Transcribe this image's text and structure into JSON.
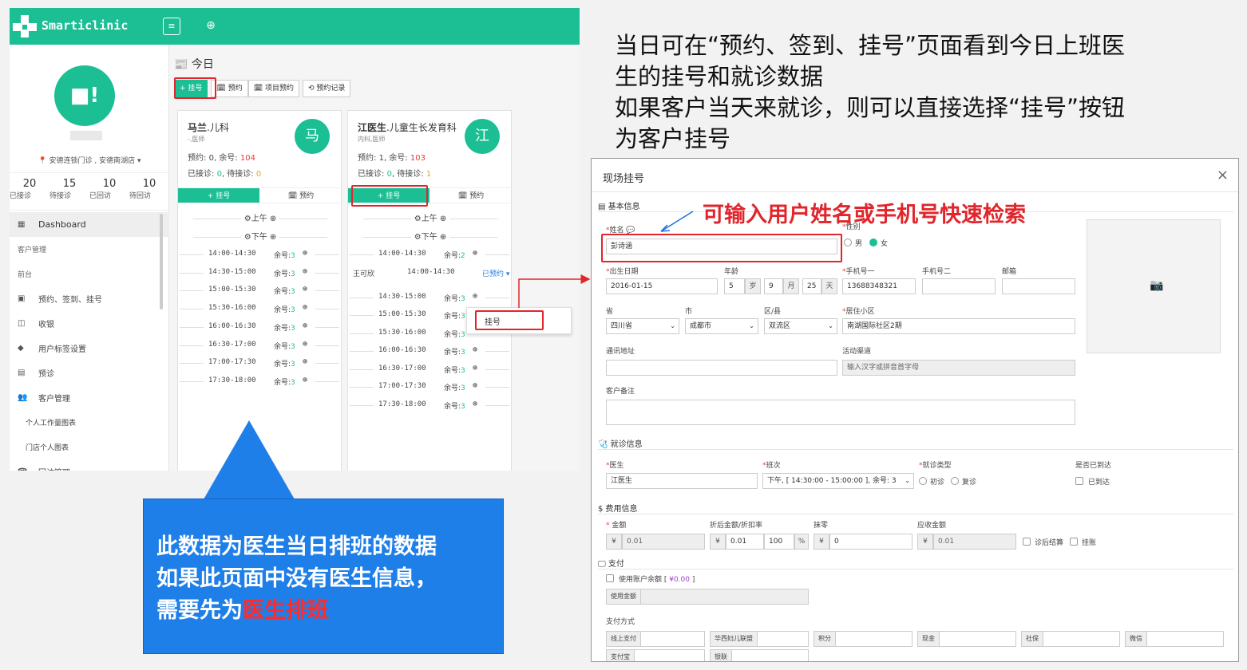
{
  "app": {
    "brand": "Smarticlinic",
    "topbar": {
      "menu_icon": "≡",
      "add_icon": "⊕"
    },
    "avatar_text": "■!",
    "store": "📍 安德连锁门诊 , 安德南湖店 ▾",
    "stats": [
      {
        "num": "20",
        "label": "已接诊"
      },
      {
        "num": "15",
        "label": "待接诊"
      },
      {
        "num": "10",
        "label": "已回访"
      },
      {
        "num": "10",
        "label": "待回访"
      }
    ],
    "menu": [
      {
        "icon": "▦",
        "label": "Dashboard",
        "type": "active"
      },
      {
        "icon": "",
        "label": "客户管理",
        "type": "section"
      },
      {
        "icon": "",
        "label": "前台",
        "type": "section"
      },
      {
        "icon": "▣",
        "label": "预约、签到、挂号",
        "type": "item"
      },
      {
        "icon": "◫",
        "label": "收银",
        "type": "item"
      },
      {
        "icon": "◆",
        "label": "用户标签设置",
        "type": "item"
      },
      {
        "icon": "▤",
        "label": "预诊",
        "type": "item"
      },
      {
        "icon": "👥",
        "label": "客户管理",
        "type": "item"
      },
      {
        "icon": "",
        "label": "个人工作量图表",
        "type": "sub"
      },
      {
        "icon": "",
        "label": "门店个人图表",
        "type": "sub"
      },
      {
        "icon": "☎",
        "label": "回访管理",
        "type": "item"
      }
    ],
    "today_title": "📰 今日",
    "actions": {
      "register": "+ 挂号",
      "appointment": "🗓 预约",
      "project_appt": "🗓 项目预约",
      "records": "⟲ 预约记录"
    },
    "doctors": [
      {
        "name_bold": "马兰",
        "name_rest": ".儿科",
        "title": "-,医师",
        "appt_label": "预约:",
        "appt_value": "0",
        "remain_label": ", 余号:",
        "remain_value": "104",
        "seen_label": "已接诊:",
        "seen_value": "0",
        "wait_label": ", 待接诊:",
        "wait_value": "0",
        "avatar": "马",
        "btn_register": "+ 挂号",
        "btn_appt": "🗓 预约",
        "morning": "⚙上午 ⊕",
        "afternoon": "⚙下午 ⊕",
        "slots": [
          {
            "time": "14:00-14:30",
            "rem_label": "余号:",
            "rem": "3"
          },
          {
            "time": "14:30-15:00",
            "rem_label": "余号:",
            "rem": "3"
          },
          {
            "time": "15:00-15:30",
            "rem_label": "余号:",
            "rem": "3"
          },
          {
            "time": "15:30-16:00",
            "rem_label": "余号:",
            "rem": "3"
          },
          {
            "time": "16:00-16:30",
            "rem_label": "余号:",
            "rem": "3"
          },
          {
            "time": "16:30-17:00",
            "rem_label": "余号:",
            "rem": "3"
          },
          {
            "time": "17:00-17:30",
            "rem_label": "余号:",
            "rem": "3"
          },
          {
            "time": "17:30-18:00",
            "rem_label": "余号:",
            "rem": "3"
          }
        ]
      },
      {
        "name_bold": "江医生",
        "name_rest": ".儿童生长发育科",
        "title": "内科,医师",
        "appt_label": "预约:",
        "appt_value": "1",
        "remain_label": ", 余号:",
        "remain_value": "103",
        "seen_label": "已接诊:",
        "seen_value": "0",
        "wait_label": ", 待接诊:",
        "wait_value": "1",
        "avatar": "江",
        "btn_register": "+ 挂号",
        "btn_appt": "🗓 预约",
        "morning": "⚙上午 ⊕",
        "afternoon": "⚙下午 ⊕",
        "slots": [
          {
            "time": "14:00-14:30",
            "rem_label": "余号:",
            "rem": "2"
          },
          {
            "time": "14:30-15:00",
            "rem_label": "余号:",
            "rem": "3"
          },
          {
            "time": "15:00-15:30",
            "rem_label": "余号:",
            "rem": "3"
          },
          {
            "time": "15:30-16:00",
            "rem_label": "余号:",
            "rem": "3"
          },
          {
            "time": "16:00-16:30",
            "rem_label": "余号:",
            "rem": "3"
          },
          {
            "time": "16:30-17:00",
            "rem_label": "余号:",
            "rem": "3"
          },
          {
            "time": "17:00-17:30",
            "rem_label": "余号:",
            "rem": "3"
          },
          {
            "time": "17:30-18:00",
            "rem_label": "余号:",
            "rem": "3"
          }
        ],
        "booked": {
          "name": "王可欣",
          "time": "14:00-14:30",
          "tag": "已预约 ▾"
        }
      }
    ],
    "popup_item": "挂号"
  },
  "callout": {
    "line1": "此数据为医生当日排班的数据",
    "line2": "如果此页面中没有医生信息，",
    "line3_prefix": "需要先为",
    "line3_highlight": "医生排班"
  },
  "instructions": {
    "line1": "当日可在“预约、签到、挂号”页面看到今日上班医",
    "line2": "生的挂号和就诊数据",
    "line3": "如果客户当天来就诊，则可以直接选择“挂号”按钮",
    "line4": "为客户挂号"
  },
  "modal": {
    "title": "现场挂号",
    "close": "×",
    "note": "可输入用户姓名或手机号快速检索",
    "basic_section": "▤ 基本信息",
    "name_label": "姓名",
    "name_value": "彭诗涵",
    "gender_label": "性别",
    "gender_male": "男",
    "gender_female": "女",
    "dob_label": "出生日期",
    "dob_value": "2016-01-15",
    "age_label": "年龄",
    "age_year": "5",
    "age_year_unit": "岁",
    "age_month": "9",
    "age_month_unit": "月",
    "age_day": "25",
    "age_day_unit": "天",
    "phone1_label": "手机号一",
    "phone1_value": "13688348321",
    "phone2_label": "手机号二",
    "email_label": "邮箱",
    "province_label": "省",
    "province_value": "四川省",
    "city_label": "市",
    "city_value": "成都市",
    "district_label": "区/县",
    "district_value": "双流区",
    "community_label": "居住小区",
    "community_value": "南湖国际社区2期",
    "address_label": "通讯地址",
    "channel_label": "活动渠道",
    "channel_placeholder": "输入汉字或拼音首字母",
    "remark_label": "客户备注",
    "visit_section": "🩺 就诊信息",
    "doctor_label": "医生",
    "doctor_value": "江医生",
    "shift_label": "班次",
    "shift_value": "下午, [ 14:30:00 - 15:00:00 ], 余号: 3",
    "visit_type_label": "就诊类型",
    "visit_first": "初诊",
    "visit_return": "复诊",
    "arrived_label": "是否已到达",
    "arrived_option": "已到达",
    "fee_section": "$ 费用信息",
    "amount_label": "金额",
    "amount_value": "0.01",
    "discount_label": "折后金额/折扣率",
    "discount_value": "0.01",
    "discount_rate": "100",
    "rounding_label": "抹零",
    "rounding_value": "0",
    "receivable_label": "应收金额",
    "receivable_value": "0.01",
    "after_settle": "诊后结算",
    "on_account": "挂账",
    "currency": "¥",
    "percent": "%",
    "pay_section": "🖵 支付",
    "use_balance": "使用账户余额 [ ",
    "balance_amount": "¥0.00",
    "balance_close": " ]",
    "use_amount_label": "使用金额",
    "pay_method_label": "支付方式",
    "pay_methods": [
      "线上支付",
      "华西妇儿联盟",
      "积分",
      "现金",
      "社保",
      "微信"
    ],
    "pay_methods2": [
      "支付宝",
      "银联"
    ],
    "camera_icon": "📷"
  }
}
